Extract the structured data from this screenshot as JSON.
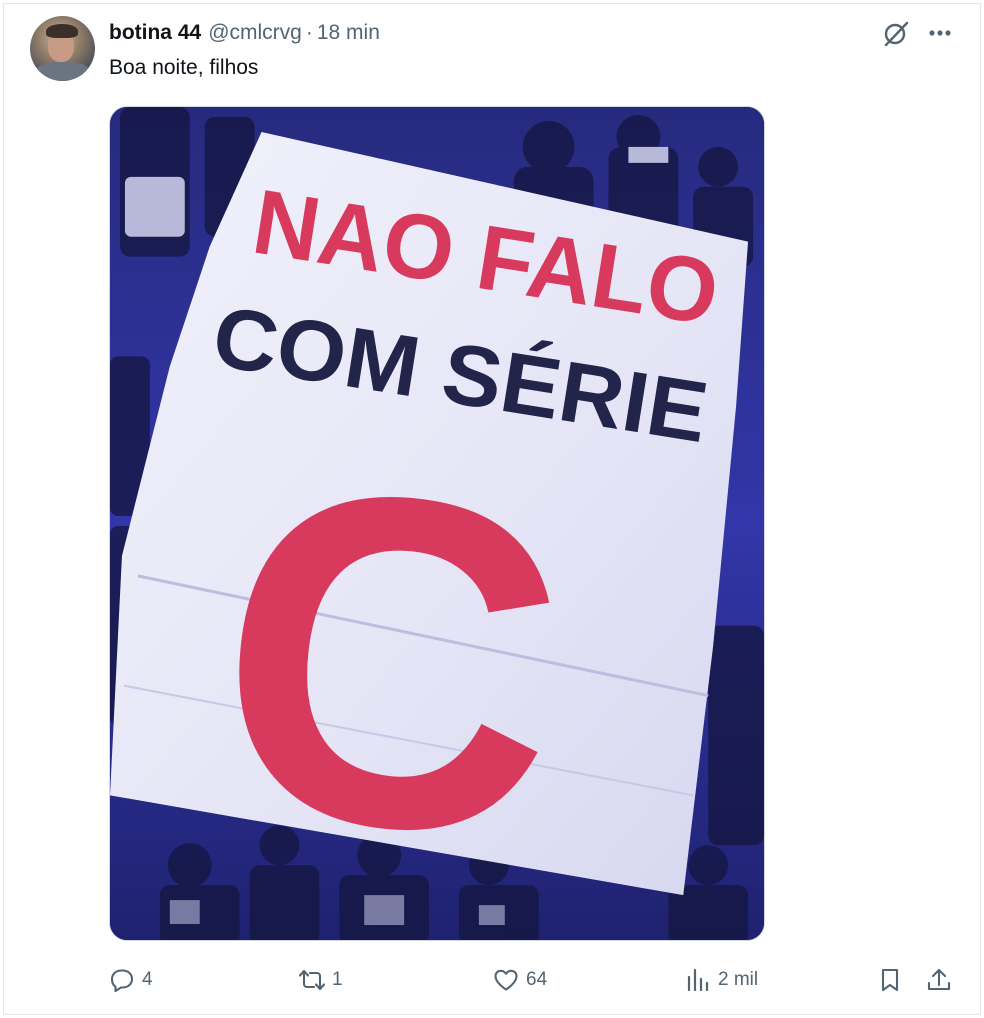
{
  "tweet": {
    "author": {
      "display_name": "botina 44",
      "handle": "@cmlcrvg",
      "separator": "·",
      "time": "18 min"
    },
    "text": "Boa noite, filhos",
    "media": {
      "banner_lines": [
        "NAO FALO",
        "COM SÉRIE",
        "C"
      ],
      "colors": {
        "banner_red": "#d83a5e",
        "banner_navy": "#23244a",
        "banner_white": "#efeff8",
        "crowd": "#2f33a0"
      }
    },
    "icons": {
      "grok": "grok-icon",
      "more": "more-icon"
    },
    "actions": {
      "replies": "4",
      "reposts": "1",
      "likes": "64",
      "views": "2 mil"
    }
  },
  "colors": {
    "text_primary": "#0f1419",
    "text_secondary": "#536471",
    "border": "#e4e7ea"
  }
}
